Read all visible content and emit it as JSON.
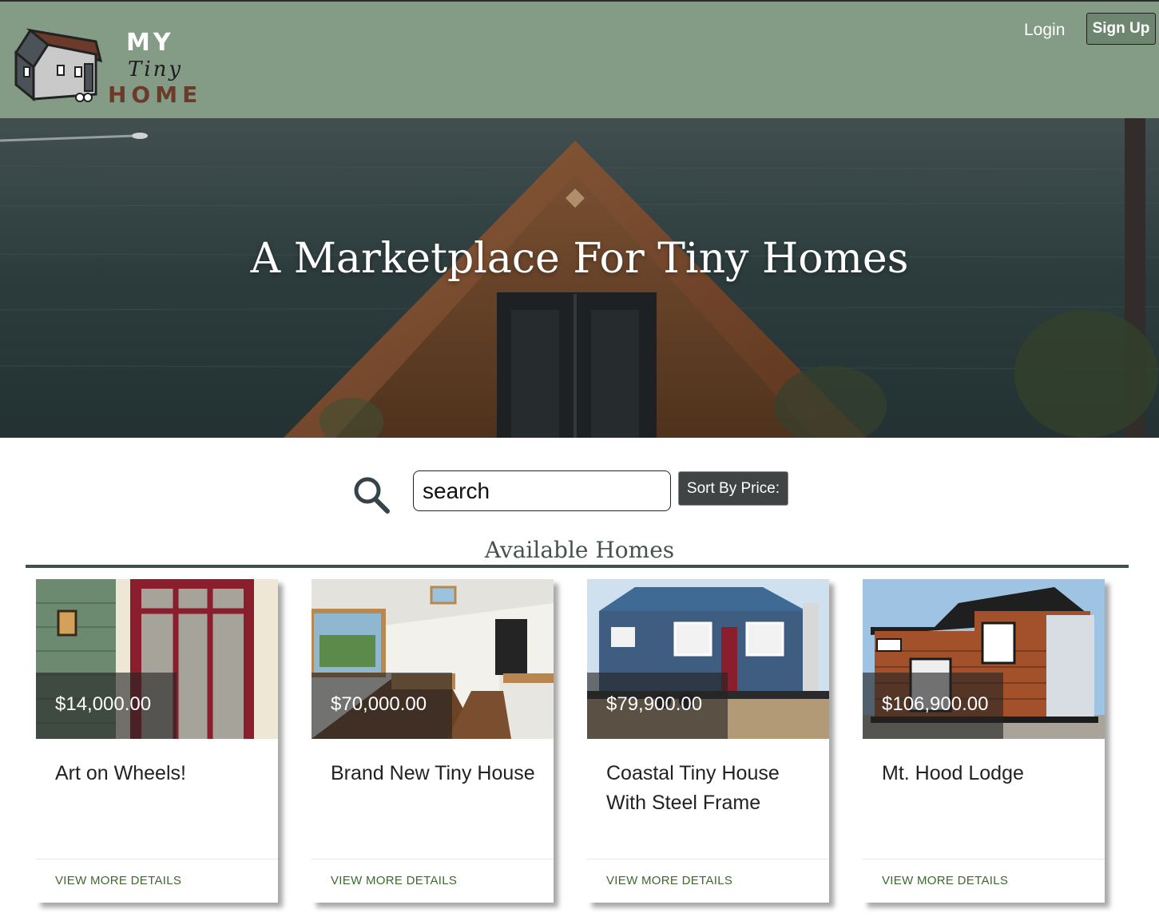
{
  "header": {
    "logo": {
      "line1": "MY",
      "line2": "Tiny",
      "line3": "HOME"
    },
    "login_label": "Login",
    "signup_label": "Sign Up"
  },
  "hero": {
    "title": "A Marketplace For Tiny Homes"
  },
  "search": {
    "icon": "search-icon",
    "placeholder": "search",
    "sort_label": "Sort By Price:"
  },
  "listings": {
    "heading": "Available Homes",
    "items": [
      {
        "price": "$14,000.00",
        "title": "Art on Wheels!",
        "link": "VIEW MORE DETAILS"
      },
      {
        "price": "$70,000.00",
        "title": "Brand New Tiny House",
        "link": "VIEW MORE DETAILS"
      },
      {
        "price": "$79,900.00",
        "title": "Coastal Tiny House With Steel Frame",
        "link": "VIEW MORE DETAILS"
      },
      {
        "price": "$106,900.00",
        "title": "Mt. Hood Lodge",
        "link": "VIEW MORE DETAILS"
      }
    ]
  },
  "colors": {
    "header_bg": "#849c86",
    "link_green": "#3c6a2c",
    "rule": "#44504d"
  }
}
